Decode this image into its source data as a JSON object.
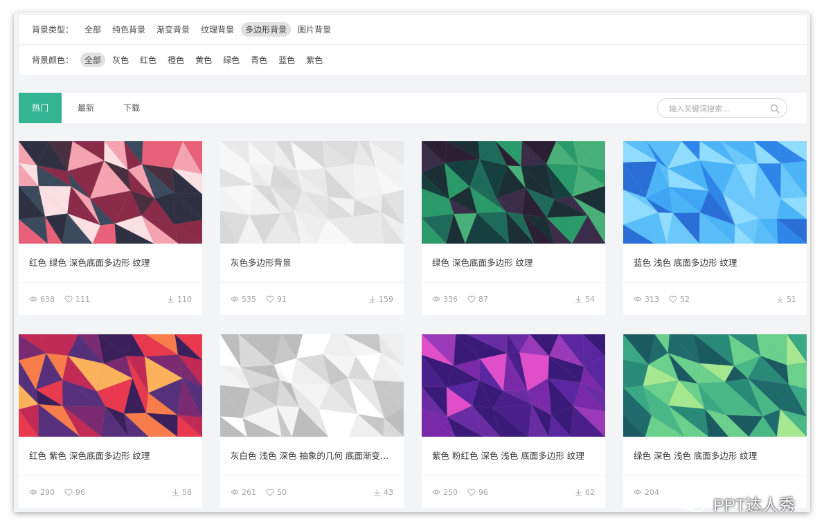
{
  "filters": {
    "type_label": "背景类型：",
    "types": [
      "全部",
      "纯色背景",
      "渐变背景",
      "纹理背景",
      "多边形背景",
      "图片背景"
    ],
    "active_type": 4,
    "color_label": "背景颜色：",
    "colors": [
      "全部",
      "灰色",
      "红色",
      "橙色",
      "黄色",
      "绿色",
      "青色",
      "蓝色",
      "紫色"
    ],
    "active_color": 0
  },
  "tabs": {
    "hot": "热门",
    "latest": "最新",
    "download": "下载",
    "active": "hot"
  },
  "search": {
    "placeholder": "输入关键词搜索..."
  },
  "cards": [
    {
      "title": "红色 绿色 深色底面多边形 纹理",
      "views": "638",
      "likes": "111",
      "downloads": "110",
      "palette": [
        "#2f3142",
        "#4a2f3e",
        "#e8607a",
        "#f5a3b0",
        "#3b4a5c",
        "#8b2b4a",
        "#fbe0e3"
      ]
    },
    {
      "title": "灰色多边形背景",
      "views": "535",
      "likes": "91",
      "downloads": "159",
      "palette": [
        "#e9e9e9",
        "#f2f2f2",
        "#dcdcdc",
        "#f7f7f7",
        "#e2e2e2",
        "#eeeeee",
        "#d8d8d8"
      ]
    },
    {
      "title": "绿色 深色底面多边形 纹理",
      "views": "336",
      "likes": "87",
      "downloads": "54",
      "palette": [
        "#1c2f34",
        "#1f6b5a",
        "#2a9a6a",
        "#3b2d4a",
        "#16403f",
        "#48b078",
        "#2a1f33"
      ]
    },
    {
      "title": "蓝色 浅色 底面多边形 纹理",
      "views": "313",
      "likes": "52",
      "downloads": "51",
      "palette": [
        "#3fa6f5",
        "#6cc7fb",
        "#2f86e8",
        "#8fdcff",
        "#4ab4f7",
        "#2a6fd6",
        "#59bdf8"
      ]
    },
    {
      "title": "红色 紫色 深色底面多边形 纹理",
      "views": "290",
      "likes": "96",
      "downloads": "58",
      "palette": [
        "#3a1f5a",
        "#e8394e",
        "#f87d4a",
        "#7a2a70",
        "#fbb25a",
        "#c02a55",
        "#56307a"
      ]
    },
    {
      "title": "灰白色 浅色 深色 抽象的几何 底面渐变多边形",
      "views": "261",
      "likes": "50",
      "downloads": "43",
      "palette": [
        "#f4f4f4",
        "#d9d9d9",
        "#c7c7c7",
        "#ffffff",
        "#e7e7e7",
        "#bdbdbd",
        "#efefef"
      ]
    },
    {
      "title": "紫色 粉红色 深色 浅色 底面多边形 纹理",
      "views": "250",
      "likes": "96",
      "downloads": "62",
      "palette": [
        "#4a1f8a",
        "#7a2aa8",
        "#5a27a0",
        "#e04fc9",
        "#3a1a78",
        "#9a3ab8",
        "#6a2ca2"
      ]
    },
    {
      "title": "绿色 深色 浅色 底面多边形 纹理",
      "views": "204",
      "likes": "",
      "downloads": "",
      "palette": [
        "#1f6a6a",
        "#2a8a78",
        "#3aa884",
        "#6ad08c",
        "#1a5a60",
        "#4ab886",
        "#a6e890"
      ]
    }
  ],
  "watermark": {
    "text": "PPT达人秀",
    "icon": "wechat-icon"
  },
  "accent": "#34b592"
}
